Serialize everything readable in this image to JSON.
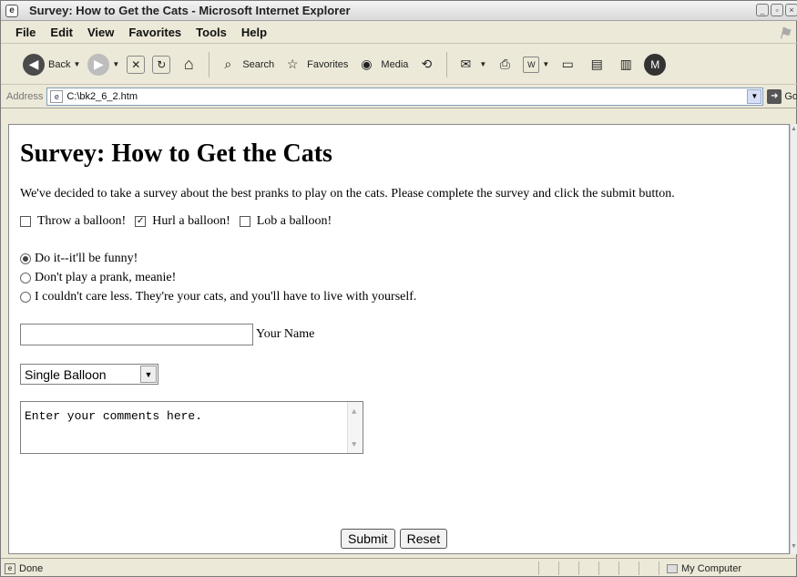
{
  "window": {
    "title": "Survey: How to Get the Cats - Microsoft Internet Explorer"
  },
  "menu": [
    "File",
    "Edit",
    "View",
    "Favorites",
    "Tools",
    "Help"
  ],
  "toolbar": {
    "back": "Back",
    "search": "Search",
    "favorites": "Favorites",
    "media": "Media"
  },
  "address": {
    "label": "Address",
    "value": "C:\\bk2_6_2.htm",
    "go": "Go"
  },
  "page": {
    "heading": "Survey: How to Get the Cats",
    "intro": "We've decided to take a survey about the best pranks to play on the cats. Please complete the survey and click the submit button.",
    "checkboxes": [
      {
        "label": "Throw a balloon!",
        "checked": false
      },
      {
        "label": "Hurl a balloon!",
        "checked": true
      },
      {
        "label": "Lob a balloon!",
        "checked": false
      }
    ],
    "radios": [
      {
        "label": "Do it--it'll be funny!",
        "checked": true
      },
      {
        "label": "Don't play a prank, meanie!",
        "checked": false
      },
      {
        "label": "I couldn't care less. They're your cats, and you'll have to live with yourself.",
        "checked": false
      }
    ],
    "name_label": "Your Name",
    "select_value": "Single Balloon",
    "comments": "Enter your comments here.",
    "submit": "Submit",
    "reset": "Reset"
  },
  "status": {
    "left": "Done",
    "zone": "My Computer"
  }
}
